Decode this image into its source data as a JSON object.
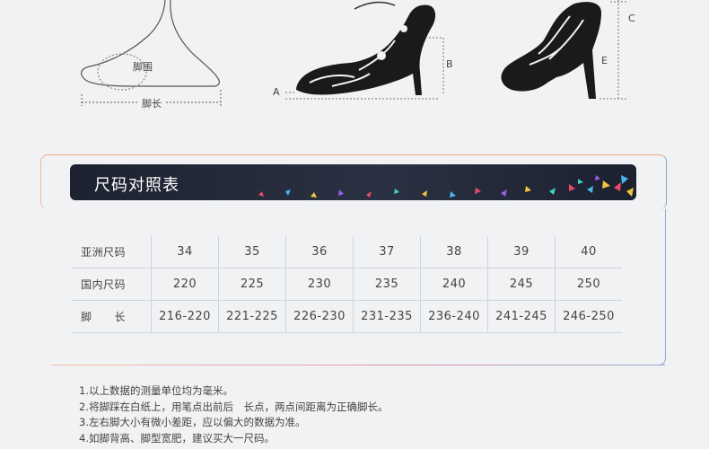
{
  "diagram": {
    "labels": {
      "foot_girth": "脚围",
      "foot_length": "脚长",
      "a": "A",
      "b": "B",
      "c": "C",
      "e": "E"
    }
  },
  "size_chart": {
    "title": "尺码对照表",
    "rows": [
      {
        "label": "亚洲尺码",
        "cells": [
          "34",
          "35",
          "36",
          "37",
          "38",
          "39",
          "40"
        ]
      },
      {
        "label": "国内尺码",
        "cells": [
          "220",
          "225",
          "230",
          "235",
          "240",
          "245",
          "250"
        ]
      },
      {
        "label": "脚　　长",
        "cells": [
          "216-220",
          "221-225",
          "226-230",
          "231-235",
          "236-240",
          "241-245",
          "246-250"
        ]
      }
    ]
  },
  "notes": [
    "1.以上数据的测量单位均为毫米。",
    "2.将脚踩在白纸上，用笔点出前后　长点，两点间距离为正确脚长。",
    "3.左右脚大小有微小差距，应以偏大的数据为准。",
    "4.如脚背高、脚型宽肥，建议买大一尺码。"
  ]
}
